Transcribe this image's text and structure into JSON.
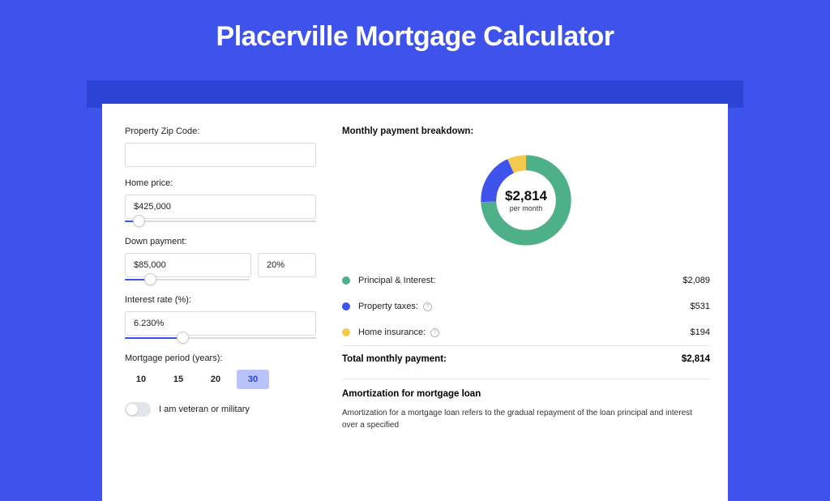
{
  "title": "Placerville Mortgage Calculator",
  "form": {
    "zip": {
      "label": "Property Zip Code:",
      "value": ""
    },
    "home_price": {
      "label": "Home price:",
      "value": "$425,000",
      "slider_pct": 7
    },
    "down_payment": {
      "label": "Down payment:",
      "amount": "$85,000",
      "percent": "20%",
      "slider_pct": 20
    },
    "interest_rate": {
      "label": "Interest rate (%):",
      "value": "6.230%",
      "slider_pct": 30
    },
    "period": {
      "label": "Mortgage period (years):",
      "options": [
        "10",
        "15",
        "20",
        "30"
      ],
      "selected": "30"
    },
    "veteran": {
      "label": "I am veteran or military",
      "on": false
    }
  },
  "breakdown": {
    "title": "Monthly payment breakdown:",
    "center_amount": "$2,814",
    "center_sub": "per month",
    "items": [
      {
        "label": "Principal & Interest:",
        "amount": "$2,089",
        "num": 2089,
        "color": "#4eb088",
        "info": false
      },
      {
        "label": "Property taxes:",
        "amount": "$531",
        "num": 531,
        "color": "#3E53EC",
        "info": true
      },
      {
        "label": "Home insurance:",
        "amount": "$194",
        "num": 194,
        "color": "#f2c94c",
        "info": true
      }
    ],
    "total": {
      "label": "Total monthly payment:",
      "amount": "$2,814",
      "num": 2814
    }
  },
  "amortization": {
    "title": "Amortization for mortgage loan",
    "text": "Amortization for a mortgage loan refers to the gradual repayment of the loan principal and interest over a specified"
  },
  "chart_data": {
    "type": "pie",
    "title": "Monthly payment breakdown",
    "categories": [
      "Principal & Interest",
      "Property taxes",
      "Home insurance"
    ],
    "values": [
      2089,
      531,
      194
    ],
    "colors": [
      "#4eb088",
      "#3E53EC",
      "#f2c94c"
    ],
    "total": 2814,
    "center_label": "$2,814 per month"
  }
}
